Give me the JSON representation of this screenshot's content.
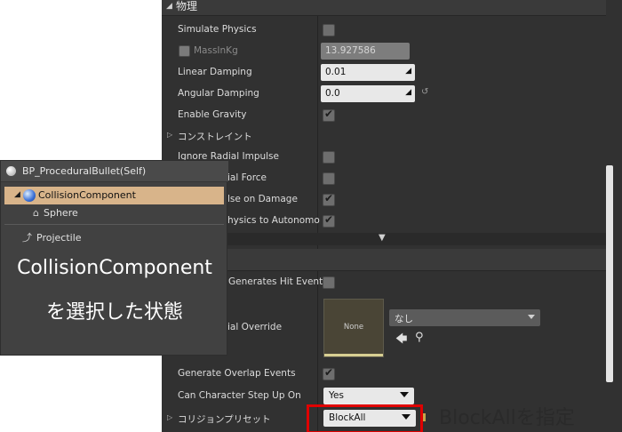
{
  "details": {
    "physics_category": "物理",
    "simulate_physics": {
      "label": "Simulate Physics",
      "checked": false
    },
    "mass": {
      "label": "MassInKg",
      "value": "13.927586",
      "reset_icon": "reset-arrow-icon"
    },
    "linear_damping": {
      "label": "Linear Damping",
      "value": "0.01"
    },
    "angular_damping": {
      "label": "Angular Damping",
      "value": "0.0"
    },
    "enable_gravity": {
      "label": "Enable Gravity",
      "checked": true
    },
    "constraints": {
      "label": "コンストレイント"
    },
    "ignore_radial_impulse": {
      "label": "Ignore Radial Impulse",
      "checked": false
    },
    "ignore_radial_force": {
      "label": "ial Force",
      "checked": false
    },
    "impulse_on_damage": {
      "label": "lse on Damage",
      "checked": true
    },
    "physics_to_autonomous": {
      "label": "hysics to Autonomo",
      "checked": true
    },
    "collision_category": "",
    "sim_hit_events": {
      "label": "Generates Hit Event",
      "checked": false
    },
    "phys_material": {
      "label": "ial Override",
      "thumb_text": "None",
      "dropdown_value": "なし"
    },
    "overlap_events": {
      "label": "Generate Overlap Events",
      "checked": true
    },
    "step_up_on": {
      "label": "Can Character Step Up On",
      "value": "Yes"
    },
    "collision_presets": {
      "label": "コリジョンプリセット",
      "value": "BlockAll"
    }
  },
  "annotation": {
    "note": "BlockAllを指定",
    "color": "#e00000"
  },
  "components": {
    "root": "BP_ProceduralBullet(Self)",
    "selected": "CollisionComponent",
    "child": "Sphere",
    "projectile": "Projectile",
    "caption_line1": "CollisionComponent",
    "caption_line2": "を選択した状態",
    "selection_color": "#d8b48a"
  }
}
